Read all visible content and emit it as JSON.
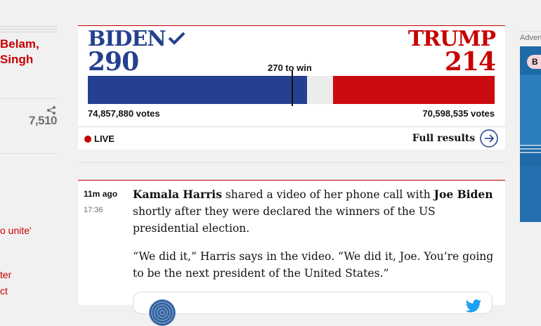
{
  "left": {
    "byline_line1": "Belam,",
    "byline_line2": "Singh",
    "share_count": "7,510",
    "link1": "o unite'",
    "link2": "ter",
    "link3": "ct"
  },
  "results": {
    "biden": {
      "name": "BIDEN",
      "electoral_votes": "290",
      "votes": "74,857,880 votes",
      "electoral_votes_value": 290
    },
    "trump": {
      "name": "TRUMP",
      "electoral_votes": "214",
      "votes": "70,598,535 votes",
      "electoral_votes_value": 214
    },
    "total_electoral_votes": 538,
    "to_win_label": "270 to win",
    "live_label": "LIVE",
    "full_results_label": "Full results",
    "colors": {
      "biden": "#25408f",
      "trump": "#cc0a11",
      "accent": "#c70000"
    }
  },
  "post": {
    "time_ago": "11m ago",
    "clock": "17:36",
    "p1_name1": "Kamala Harris",
    "p1_text1": " shared a video of her phone call with ",
    "p1_name2": "Joe Biden",
    "p1_text2": " shortly after they were declared the winners of the US presidential election.",
    "p2": "“We did it,” Harris says in the video. “We did it, Joe. You’re going to be the next president of the United States.”"
  },
  "advert": {
    "label": "Advertisement",
    "pill": "B"
  },
  "icons": [
    "share-icon",
    "check-icon",
    "arrow-right-circle-icon",
    "live-dot-icon",
    "twitter-bird-icon"
  ]
}
